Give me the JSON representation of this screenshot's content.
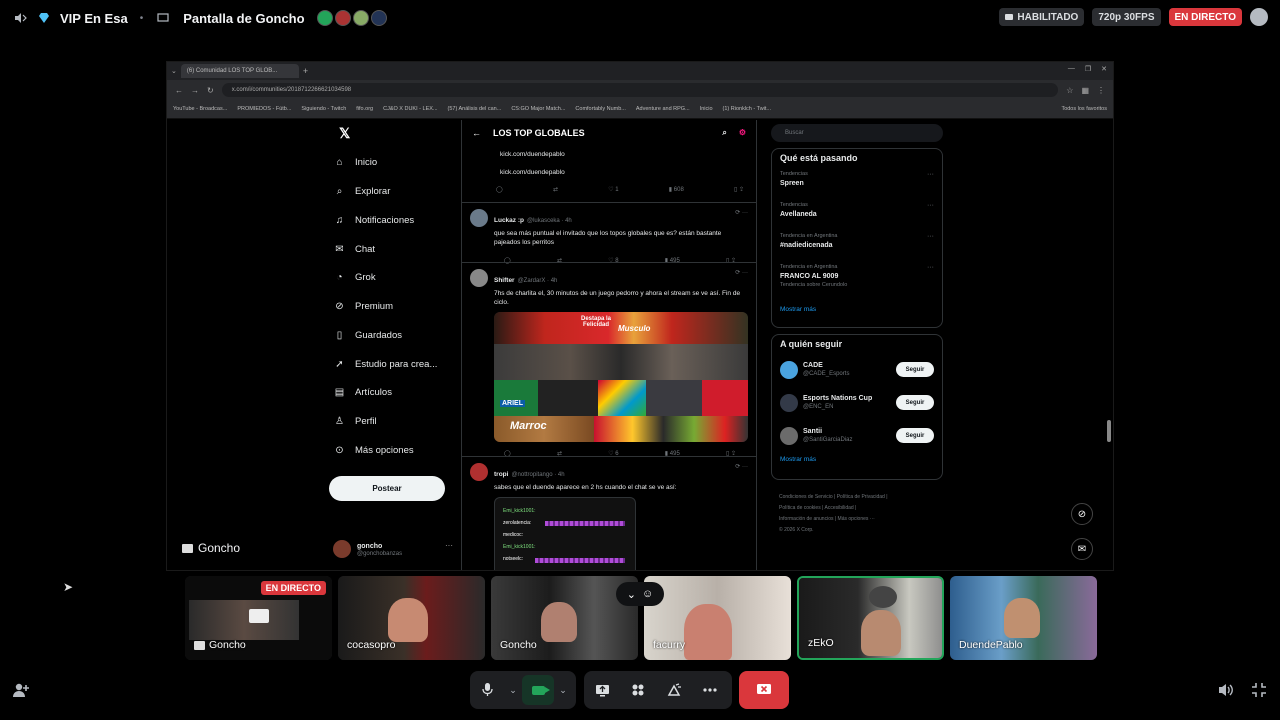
{
  "topbar": {
    "channel": "VIP En Esa",
    "title": "Pantalla de Goncho",
    "habilitado": "HABILITADO",
    "quality": "720p 30FPS",
    "live": "EN DIRECTO"
  },
  "browser": {
    "tab_title": "(6) Comunidad LOS TOP GLOB...",
    "url": "x.com/i/communities/2018712266621034598",
    "bookmarks": [
      "YouTube - Broadcas...",
      "PROMIEDOS - Fútb...",
      "Siguiendo - Twitch",
      "fifo.org",
      "CJ&O X DUKI - LEX...",
      "(57) Análisis del can...",
      "CS:GO Major Match...",
      "Comfortably Numb...",
      "Adventure and RPG...",
      "Inicio",
      "(1) Rionklch - Twit...",
      "Todos los favoritos"
    ]
  },
  "x": {
    "nav": [
      {
        "icon": "home-icon",
        "label": "Inicio"
      },
      {
        "icon": "search-icon",
        "label": "Explorar"
      },
      {
        "icon": "bell-icon",
        "label": "Notificaciones"
      },
      {
        "icon": "mail-icon",
        "label": "Chat"
      },
      {
        "icon": "grok-icon",
        "label": "Grok"
      },
      {
        "icon": "premium-icon",
        "label": "Premium"
      },
      {
        "icon": "bookmark-icon",
        "label": "Guardados"
      },
      {
        "icon": "rocket-icon",
        "label": "Estudio para crea..."
      },
      {
        "icon": "article-icon",
        "label": "Artículos"
      },
      {
        "icon": "person-icon",
        "label": "Perfil"
      },
      {
        "icon": "more-icon",
        "label": "Más opciones"
      }
    ],
    "post_button": "Postear",
    "me": {
      "name": "goncho",
      "handle": "@gonchobanzas"
    },
    "community_title": "LOS TOP GLOBALES",
    "links": [
      "kick.com/duendepablo",
      "kick.com/duendepablo"
    ],
    "first_actions": {
      "likes": "1",
      "views": "608"
    },
    "tweets": [
      {
        "name": "Luckaz :p",
        "meta": "@lukasceka · 4h",
        "text": "que sea más puntual el invitado que los topos globales que es? están bastante pajeados los perritos",
        "likes": "8",
        "views": "495"
      },
      {
        "name": "Shifter",
        "meta": "@ZardarX · 4h",
        "text": "7hs de charlita el, 30 minutos de un juego pedorro y ahora el stream se ve así. Fin de ciclo.",
        "likes": "6",
        "views": "495"
      },
      {
        "name": "tropi",
        "meta": "@nottropitango · 4h",
        "text": "sabes que el duende aparece en 2 hs cuando el chat se ve así:",
        "likes": "",
        "views": ""
      }
    ],
    "media_labels": {
      "banner": "Destapa la Felicidad",
      "brand": "Musculo",
      "ariel": "ARIEL",
      "marroc": "Marroc"
    },
    "chat_lines": [
      "Emi_kick1001:",
      "zerolatencia:",
      "medicoc:",
      "Emi_kick1001:",
      "notseelc:"
    ],
    "search_placeholder": "Buscar",
    "trends_title": "Qué está pasando",
    "trends": [
      {
        "label": "Tendencias",
        "name": "Spreen",
        "sub": ""
      },
      {
        "label": "Tendencias",
        "name": "Avellaneda",
        "sub": ""
      },
      {
        "label": "Tendencia en Argentina",
        "name": "#nadiedicenada",
        "sub": ""
      },
      {
        "label": "Tendencia en Argentina",
        "name": "FRANCO AL 9009",
        "sub": "Tendencia sobre Cerundolo"
      }
    ],
    "show_more": "Mostrar más",
    "follow_title": "A quién seguir",
    "follow": [
      {
        "name": "CADE",
        "handle": "@CADE_Esports",
        "btn": "Seguir",
        "color": "#4aa3df"
      },
      {
        "name": "Esports Nations Cup",
        "handle": "@ENC_EN",
        "btn": "Seguir",
        "color": "#333a48"
      },
      {
        "name": "Santii",
        "handle": "@SantiGarciaDiaz",
        "btn": "Seguir",
        "color": "#6b6b6b"
      }
    ],
    "show_more_2": "Mostrar más",
    "footer": [
      "Condiciones de Servicio | Política de Privacidad |",
      "Política de cookies | Accesibilidad |",
      "Información de anuncios | Más opciones ···",
      "© 2026 X Corp."
    ]
  },
  "stream_label": "Goncho",
  "tiles": [
    {
      "name": "Goncho",
      "live": "EN DIRECTO"
    },
    {
      "name": "cocasopro"
    },
    {
      "name": "Goncho"
    },
    {
      "name": "facurry"
    },
    {
      "name": "zEkO"
    },
    {
      "name": "DuendePablo"
    }
  ],
  "colors": {
    "live_red": "#da373c",
    "speaking_green": "#23a55a",
    "x_blue": "#1d9bf0"
  }
}
